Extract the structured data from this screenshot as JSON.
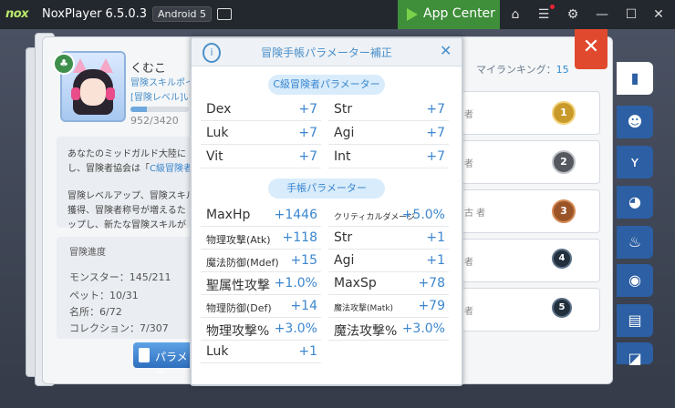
{
  "titlebar": {
    "logo": "nox",
    "app_title": "NoxPlayer 6.5.0.3",
    "android": "Android 5",
    "app_center": "App Center"
  },
  "profile": {
    "name": "くむこ",
    "sub1": "冒険スキルポイ",
    "sub2": "[冒険レベル]い",
    "exp_text": "952/3420",
    "exp_fraction": 0.278
  },
  "description": {
    "line1a": "あなたのミッドガルド大陸に",
    "line1b": "し、冒険者協会は「",
    "line1_highlight": "C級冒険者",
    "line2a": "冒険レベルアップ、冒険スキル",
    "line2b": "獲得、冒険者称号が増えるた",
    "line2c": "ップし、新たな冒険スキルが"
  },
  "progress": {
    "label": "冒険進度",
    "items": [
      {
        "text": "モンスター：145/211"
      },
      {
        "text": "ペット：10/31"
      },
      {
        "text": "名所：6/72"
      },
      {
        "text": "コレクション：7/307"
      }
    ]
  },
  "parameter_button": "パラメー",
  "ranking": {
    "label": "マイランキング：",
    "value": "15",
    "rows": [
      {
        "suffix": "者",
        "medal": "1"
      },
      {
        "suffix": "者",
        "medal": "2"
      },
      {
        "suffix": "古 者",
        "medal": "3"
      },
      {
        "suffix": "者",
        "medal": "4"
      },
      {
        "suffix": "者",
        "medal": "5"
      }
    ]
  },
  "popup": {
    "title": "冒険手帳パラメーター補正",
    "section1": "C級冒険者パラメーター",
    "section2": "手帳パラメーター",
    "s1_rows": [
      {
        "l_name": "Dex",
        "l_val": "+7",
        "r_name": "Str",
        "r_val": "+7"
      },
      {
        "l_name": "Luk",
        "l_val": "+7",
        "r_name": "Agi",
        "r_val": "+7"
      },
      {
        "l_name": "Vit",
        "l_val": "+7",
        "r_name": "Int",
        "r_val": "+7"
      }
    ],
    "s2_rows": [
      {
        "l_name": "MaxHp",
        "l_val": "+1446",
        "r_name": "クリティカルダメージ",
        "r_val": "+5.0%"
      },
      {
        "l_name": "物理攻撃(Atk)",
        "l_val": "+118",
        "r_name": "Str",
        "r_val": "+1"
      },
      {
        "l_name": "魔法防御(Mdef)",
        "l_val": "+15",
        "r_name": "Agi",
        "r_val": "+1"
      },
      {
        "l_name": "聖属性攻撃",
        "l_val": "+1.0%",
        "r_name": "MaxSp",
        "r_val": "+78"
      },
      {
        "l_name": "物理防御(Def)",
        "l_val": "+14",
        "r_name": "魔法攻撃(Matk)",
        "r_val": "+79"
      },
      {
        "l_name": "物理攻撃%",
        "l_val": "+3.0%",
        "r_name": "魔法攻撃%",
        "r_val": "+3.0%"
      },
      {
        "l_name": "Luk",
        "l_val": "+1",
        "r_name": "",
        "r_val": ""
      }
    ]
  }
}
